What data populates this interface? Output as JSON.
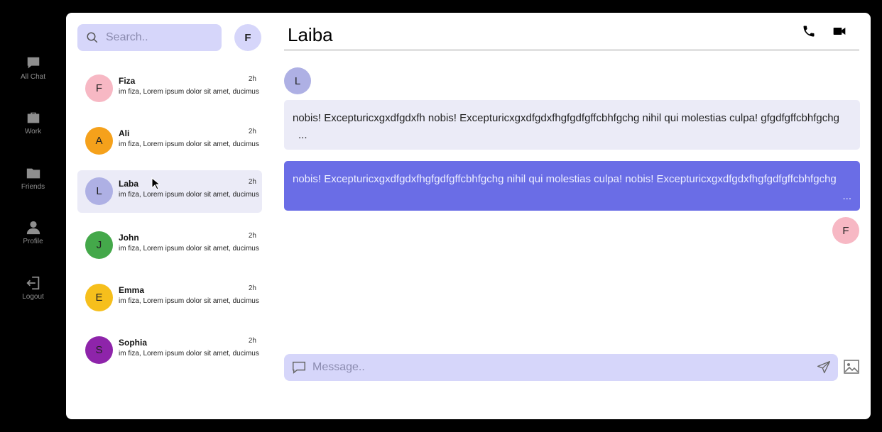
{
  "nav": {
    "items": [
      {
        "label": "All Chat",
        "icon": "chat-bubble-icon"
      },
      {
        "label": "Work",
        "icon": "briefcase-icon"
      },
      {
        "label": "Friends",
        "icon": "folder-icon"
      },
      {
        "label": "Profile",
        "icon": "person-icon"
      },
      {
        "label": "Logout",
        "icon": "logout-icon"
      }
    ]
  },
  "search": {
    "placeholder": "Search.."
  },
  "self": {
    "initial": "F"
  },
  "chats": [
    {
      "initial": "F",
      "name": "Fiza",
      "time": "2h",
      "preview": "im fiza, Lorem ipsum dolor sit amet, ducimus",
      "color": "#f7b8c4"
    },
    {
      "initial": "A",
      "name": "Ali",
      "time": "2h",
      "preview": "im fiza, Lorem ipsum dolor sit amet, ducimus",
      "color": "#f5a11b"
    },
    {
      "initial": "L",
      "name": "Laba",
      "time": "2h",
      "preview": "im fiza, Lorem ipsum dolor sit amet, ducimus",
      "color": "#aeb0e4"
    },
    {
      "initial": "J",
      "name": "John",
      "time": "2h",
      "preview": "im fiza, Lorem ipsum dolor sit amet, ducimus",
      "color": "#44a84a"
    },
    {
      "initial": "E",
      "name": "Emma",
      "time": "2h",
      "preview": "im fiza, Lorem ipsum dolor sit amet, ducimus",
      "color": "#f6bf1c"
    },
    {
      "initial": "S",
      "name": "Sophia",
      "time": "2h",
      "preview": "im fiza, Lorem ipsum dolor sit amet, ducimus",
      "color": "#8e24aa"
    }
  ],
  "conversation": {
    "title": "Laiba",
    "call_icon": "phone-icon",
    "video_icon": "video-camera-icon",
    "incoming": {
      "avatar_initial": "L",
      "avatar_color": "#aeb0e4",
      "text": "nobis! Excepturicxgxdfgdxfh nobis! Excepturicxgxdfgdxfhgfgdfgffcbhfgchg nihil qui molestias culpa! gfgdfgffcbhfgchg",
      "more": "...",
      "bg": "#ebebf7"
    },
    "outgoing": {
      "avatar_initial": "F",
      "avatar_color": "#f7b8c4",
      "text": "nobis! Excepturicxgxdfgdxfhgfgdfgffcbhfgchg nihil qui molestias culpa! nobis! Excepturicxgxdfgdxfhgfgdfgffcbhfgchg",
      "more": "...",
      "bg": "#6a6de6"
    }
  },
  "composer": {
    "placeholder": "Message..",
    "send_icon": "send-icon",
    "image_icon": "image-icon"
  }
}
